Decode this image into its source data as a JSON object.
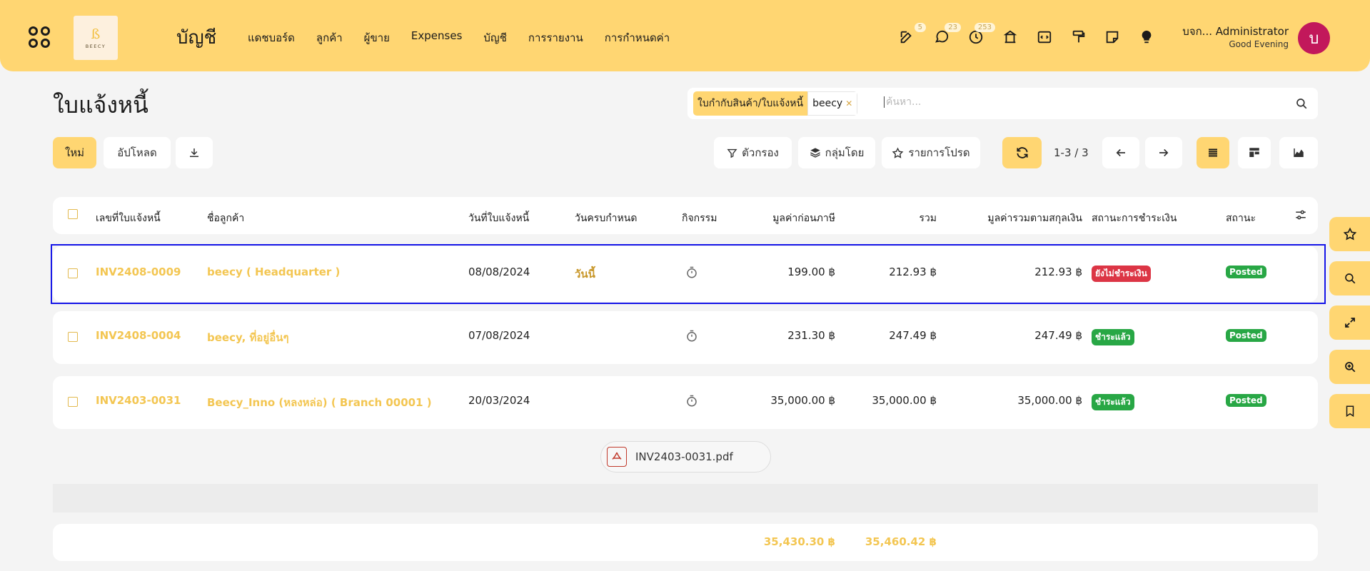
{
  "navbar": {
    "brand": "บัญชี",
    "menu": [
      "แดชบอร์ด",
      "ลูกค้า",
      "ผู้ขาย",
      "Expenses",
      "บัญชี",
      "การรายงาน",
      "การกำหนดค่า"
    ],
    "logo_text": "BEECY",
    "badges": {
      "todo": "5",
      "chat": "23",
      "activity": "253"
    },
    "user": {
      "name": "บจก... Administrator",
      "greeting": "Good Evening",
      "initial": "บ",
      "avatar_color": "#c2185b"
    },
    "accent_color": "#ffd672"
  },
  "page": {
    "title": "ใบแจ้งหนี้"
  },
  "search": {
    "facet_label": "ใบกำกับสินค้า/ใบแจ้งหนี้",
    "facet_value": "beecy",
    "placeholder": "ค้นหา..."
  },
  "toolbar": {
    "new_label": "ใหม่",
    "upload_label": "อัปโหลด",
    "filter_label": "ตัวกรอง",
    "groupby_label": "กลุ่มโดย",
    "favorites_label": "รายการโปรด",
    "pager": "1-3 / 3"
  },
  "table": {
    "columns": [
      "เลขที่ใบแจ้งหนี้",
      "ชื่อลูกค้า",
      "วันที่ใบแจ้งหนี้",
      "วันครบกำหนด",
      "กิจกรรม",
      "มูลค่าก่อนภาษี",
      "รวม",
      "มูลค่ารวมตามสกุลเงิน",
      "สถานะการชำระเงิน",
      "สถานะ"
    ],
    "rows": [
      {
        "number": "INV2408-0009",
        "customer": "beecy ( Headquarter )",
        "date": "08/08/2024",
        "due": "วันนี้",
        "untaxed": "199.00 ฿",
        "total": "212.93 ฿",
        "total_currency": "212.93 ฿",
        "payment": "ยังไม่ชำระเงิน",
        "payment_color": "#dc3545",
        "state": "Posted"
      },
      {
        "number": "INV2408-0004",
        "customer": "beecy, ที่อยู่อื่นๆ",
        "date": "07/08/2024",
        "due": "",
        "untaxed": "231.30 ฿",
        "total": "247.49 ฿",
        "total_currency": "247.49 ฿",
        "payment": "ชำระแล้ว",
        "payment_color": "#28a745",
        "state": "Posted"
      },
      {
        "number": "INV2403-0031",
        "customer": "Beecy_Inno (หลงหล่อ) ( Branch 00001 )",
        "date": "20/03/2024",
        "due": "",
        "untaxed": "35,000.00 ฿",
        "total": "35,000.00 ฿",
        "total_currency": "35,000.00 ฿",
        "payment": "ชำระแล้ว",
        "payment_color": "#28a745",
        "state": "Posted"
      }
    ],
    "attachment": "INV2403-0031.pdf",
    "totals": {
      "untaxed": "35,430.30 ฿",
      "total": "35,460.42 ฿"
    }
  }
}
